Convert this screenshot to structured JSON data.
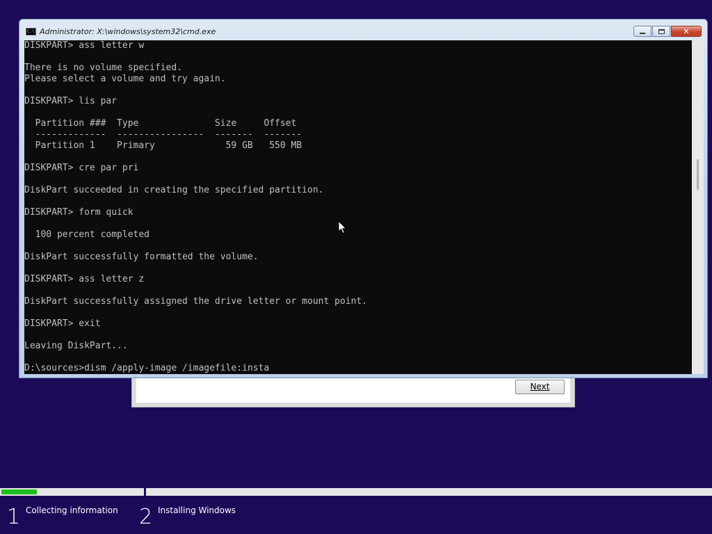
{
  "window": {
    "title": "Administrator: X:\\windows\\system32\\cmd.exe",
    "icon_label": "C:\\",
    "close_label": "✕"
  },
  "console": {
    "text": "DISKPART> ass letter w\n\nThere is no volume specified.\nPlease select a volume and try again.\n\nDISKPART> lis par\n\n  Partition ###  Type              Size     Offset\n  -------------  ----------------  -------  -------\n  Partition 1    Primary             59 GB   550 MB\n\nDISKPART> cre par pri\n\nDiskPart succeeded in creating the specified partition.\n\nDISKPART> form quick\n\n  100 percent completed\n\nDiskPart successfully formatted the volume.\n\nDISKPART> ass letter z\n\nDiskPart successfully assigned the drive letter or mount point.\n\nDISKPART> exit\n\nLeaving DiskPart...\n\nD:\\sources>dism /apply-image /imagefile:insta"
  },
  "setup": {
    "next_button": "Next"
  },
  "progress": {
    "fraction": 0.05,
    "steps": [
      {
        "number": "1",
        "label": "Collecting information"
      },
      {
        "number": "2",
        "label": "Installing Windows"
      }
    ]
  },
  "colors": {
    "background": "#1c0a59",
    "progress_fill": "#1ec01e",
    "console_bg": "#0c0c0c",
    "console_text": "#c0c0c0"
  }
}
